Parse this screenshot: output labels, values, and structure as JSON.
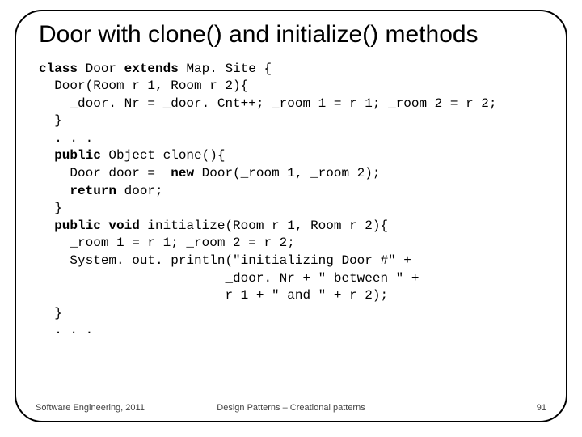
{
  "title": "Door with clone() and initialize() methods",
  "code": {
    "l01a": "class",
    "l01b": " Door ",
    "l01c": "extends",
    "l01d": " Map. Site {",
    "l02": "  Door(Room r 1, Room r 2){",
    "l03": "    _door. Nr = _door. Cnt++; _room 1 = r 1; _room 2 = r 2;",
    "l04": "  }",
    "l05": "  . . .",
    "l06a": "  ",
    "l06b": "public",
    "l06c": " Object clone(){",
    "l07a": "    Door door =  ",
    "l07b": "new",
    "l07c": " Door(_room 1, _room 2);",
    "l08a": "    ",
    "l08b": "return",
    "l08c": " door;",
    "l09": "  }",
    "l10a": "  ",
    "l10b": "public void",
    "l10c": " initialize(Room r 1, Room r 2){",
    "l11": "    _room 1 = r 1; _room 2 = r 2;",
    "l12": "    System. out. println(\"initializing Door #\" +",
    "l13": "                        _door. Nr + \" between \" +",
    "l14": "                        r 1 + \" and \" + r 2);",
    "l15": "  }",
    "l16": "  . . ."
  },
  "footer": {
    "left": "Software Engineering, 2011",
    "center": "Design Patterns – Creational patterns",
    "right": "91"
  }
}
